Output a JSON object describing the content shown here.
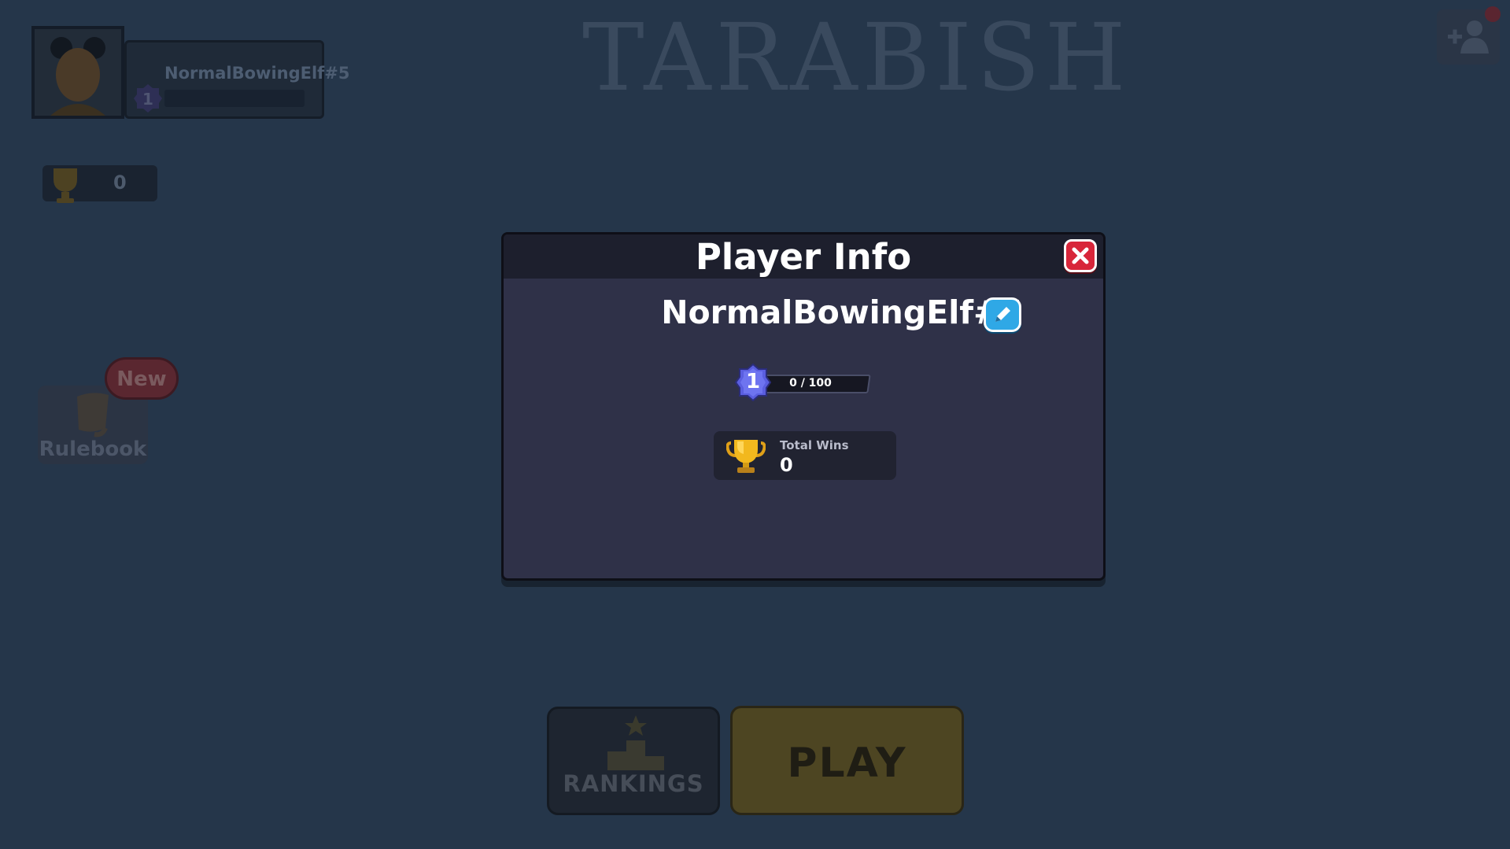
{
  "background": {
    "game_title": "TARABISH",
    "profile": {
      "name": "NormalBowingElf#5",
      "level": "1"
    },
    "trophy_count": "0",
    "rulebook": {
      "label": "Rulebook",
      "badge": "New"
    },
    "rankings_label": "RANKINGS",
    "play_label": "PLAY"
  },
  "modal": {
    "title": "Player Info",
    "player_name": "NormalBowingElf#5",
    "level": "1",
    "xp_text": "0 / 100",
    "xp_progress": 0,
    "stats": {
      "total_wins_label": "Total Wins",
      "total_wins_value": "0"
    }
  },
  "colors": {
    "modal_bg": "#2f3148",
    "modal_header": "#1d1f2d",
    "close_red": "#d8263a",
    "edit_blue": "#2fa8e6",
    "level_badge": "#5a5ee0",
    "trophy_gold": "#f2b81e"
  },
  "icons": [
    "close-icon",
    "pencil-icon",
    "level-badge-icon",
    "trophy-icon",
    "add-friend-icon",
    "scroll-icon",
    "podium-icon"
  ]
}
